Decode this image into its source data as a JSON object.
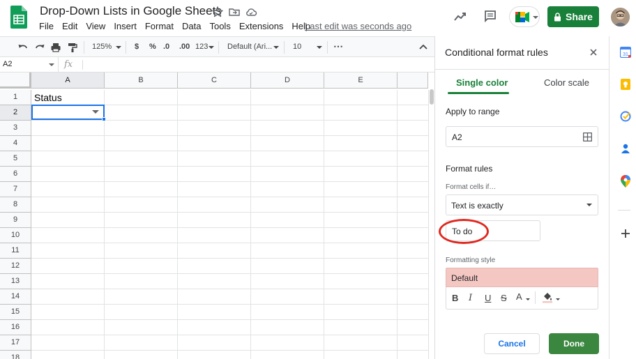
{
  "app": {
    "doc_title": "Drop-Down Lists in Google Sheets",
    "menu": [
      "File",
      "Edit",
      "View",
      "Insert",
      "Format",
      "Data",
      "Tools",
      "Extensions",
      "Help"
    ],
    "last_edit": "Last edit was seconds ago",
    "share_label": "Share",
    "brand_color": "#188038"
  },
  "toolbar": {
    "zoom": "125%",
    "currency": "$",
    "percent": "%",
    "dec_less": ".0",
    "dec_more": ".00",
    "more_formats": "123",
    "font": "Default (Ari...",
    "font_size": "10",
    "more": "⋯"
  },
  "formula_bar": {
    "name_box": "A2",
    "fx": "fx"
  },
  "grid": {
    "columns": [
      "A",
      "B",
      "C",
      "D",
      "E"
    ],
    "rows": [
      "1",
      "2",
      "3",
      "4",
      "5",
      "6",
      "7",
      "8",
      "9",
      "10",
      "11",
      "12",
      "13",
      "14",
      "15",
      "16",
      "17",
      "18"
    ],
    "a1_value": "Status"
  },
  "panel": {
    "title": "Conditional format rules",
    "tab_single": "Single color",
    "tab_scale": "Color scale",
    "apply_to_range_label": "Apply to range",
    "range_value": "A2",
    "format_rules_label": "Format rules",
    "format_cells_if_label": "Format cells if…",
    "condition": "Text is exactly",
    "value": "To do",
    "formatting_style_label": "Formatting style",
    "style_preview": "Default",
    "style_color": "#f4c7c3",
    "fmt_bold": "B",
    "fmt_italic": "I",
    "fmt_underline": "U",
    "fmt_strike": "S",
    "fmt_text_color": "A",
    "cancel": "Cancel",
    "done": "Done"
  }
}
